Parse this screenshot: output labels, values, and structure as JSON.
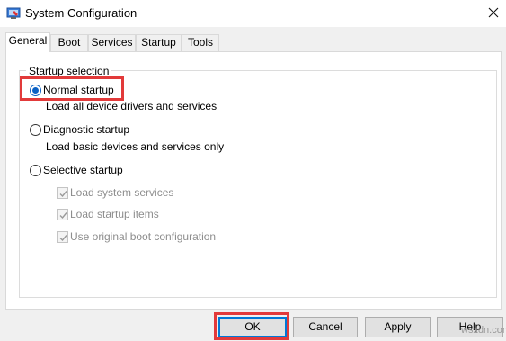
{
  "window": {
    "title": "System Configuration",
    "icon": "system-config-icon",
    "close_icon": "close-icon"
  },
  "tabs": [
    {
      "label": "General",
      "active": true
    },
    {
      "label": "Boot",
      "active": false
    },
    {
      "label": "Services",
      "active": false
    },
    {
      "label": "Startup",
      "active": false
    },
    {
      "label": "Tools",
      "active": false
    }
  ],
  "startup_selection": {
    "legend": "Startup selection",
    "normal": {
      "label": "Normal startup",
      "description": "Load all device drivers and services",
      "selected": true
    },
    "diagnostic": {
      "label": "Diagnostic startup",
      "description": "Load basic devices and services only",
      "selected": false
    },
    "selective": {
      "label": "Selective startup",
      "selected": false,
      "options": [
        {
          "label": "Load system services",
          "checked": true,
          "enabled": false
        },
        {
          "label": "Load startup items",
          "checked": true,
          "enabled": false
        },
        {
          "label": "Use original boot configuration",
          "checked": true,
          "enabled": false
        }
      ]
    }
  },
  "buttons": {
    "ok": "OK",
    "cancel": "Cancel",
    "apply": "Apply",
    "help": "Help"
  },
  "highlight_color": "#e23a3a",
  "accent_color": "#0078d7",
  "watermark": "wsxdn.com"
}
